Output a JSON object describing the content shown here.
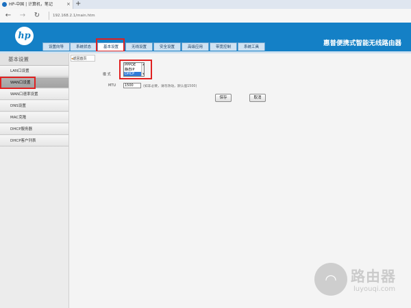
{
  "browser": {
    "tab_title": "HP-中国 | 计算机，笔记",
    "tab_close": "×",
    "new_tab": "+",
    "back": "←",
    "forward": "→",
    "refresh": "↻",
    "url": "192.168.2.1/main.htm"
  },
  "header": {
    "logo_text": "hp",
    "title": "惠普便携式智能无线路由器",
    "menu": [
      {
        "label": "设置向导"
      },
      {
        "label": "系统状态"
      },
      {
        "label": "基本设置",
        "active": true
      },
      {
        "label": "无线设置"
      },
      {
        "label": "安全设置"
      },
      {
        "label": "高级应用"
      },
      {
        "label": "带宽控制"
      },
      {
        "label": "系统工具"
      }
    ]
  },
  "sidebar": {
    "heading": "基本设置",
    "items": [
      {
        "label": "LAN口设置"
      },
      {
        "label": "WAN口设置",
        "active": true
      },
      {
        "label": "WAN口速率设置"
      },
      {
        "label": "DNS设置"
      },
      {
        "label": "MAC克隆"
      },
      {
        "label": "DHCP服务器"
      },
      {
        "label": "DHCP客户列表"
      }
    ]
  },
  "main": {
    "back_tab": "返回首页",
    "mode_label": "模 式",
    "mode_options": [
      "PPPOE",
      "静态IP",
      "DHCP"
    ],
    "mode_selected": "DHCP",
    "mtu_label": "MTU",
    "mtu_value": "1500",
    "mtu_hint": "(如非必要，请勿改动，默认值1500)",
    "save_label": "保存",
    "cancel_label": "取消"
  },
  "watermark": {
    "text": "路由器",
    "url": "luyouqi.com"
  },
  "colors": {
    "header_blue": "#1480c6",
    "highlight_red": "#e02020",
    "selected_option": "#2f7bd8"
  }
}
